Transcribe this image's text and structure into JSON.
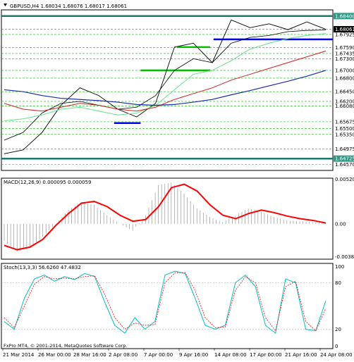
{
  "colors": {
    "background": "#ffffff",
    "panel_bg": "#000000",
    "grid": "#00c000",
    "price": "#000000",
    "ma_fast": "#000000",
    "ma_green": "#66e08a",
    "ma_red": "#d62020",
    "ma_blue": "#1a2bb0",
    "hline_teal": "#1a7a6e",
    "hline_blue": "#0000ff",
    "hline_green": "#00c000",
    "macd_hist": "#999999",
    "macd_signal": "#ff0000",
    "stoch_main": "#00c0c0",
    "stoch_signal": "#ff0000",
    "price_tag_bg": "#000000",
    "price_tag_text": "#ffffff",
    "level_tag_bg": "#2e9a86",
    "level_tag_text": "#ffffff"
  },
  "header": {
    "symbol_line": "GBPUSD,H4  1.68034  1.68076  1.68017  1.68061"
  },
  "chart_data": [
    {
      "type": "line",
      "panel": "price",
      "title": "GBPUSD,H4",
      "ohlc_header": {
        "open": 1.68034,
        "high": 1.68076,
        "low": 1.68017,
        "close": 1.68061
      },
      "ylim": [
        1.6442,
        1.6856
      ],
      "y_ticks": [
        "1.68400",
        "1.68061",
        "1.67925",
        "1.67590",
        "1.67435",
        "1.67300",
        "1.67000",
        "1.66800",
        "1.66450",
        "1.66200",
        "1.66080",
        "1.65675",
        "1.65500",
        "1.65350",
        "1.64975",
        "1.64725",
        "1.64570"
      ],
      "price_tag": "1.68061",
      "level_tags": [
        "1.68400",
        "1.64725"
      ],
      "horizontal_levels": [
        {
          "price": 1.684,
          "style": "thick",
          "color": "#1a7a6e"
        },
        {
          "price": 1.64725,
          "style": "thick",
          "color": "#1a7a6e"
        },
        {
          "price": 1.678,
          "style": "thick",
          "color": "#0000ff",
          "from": 0.64,
          "to": 1.0
        },
        {
          "price": 1.6564,
          "style": "thick",
          "color": "#0000ff",
          "from": 0.34,
          "to": 0.42
        },
        {
          "price": 1.67,
          "style": "thick",
          "color": "#00c000",
          "from": 0.42,
          "to": 0.63
        },
        {
          "price": 1.676,
          "style": "thick",
          "color": "#00c000",
          "from": 0.53,
          "to": 0.63
        }
      ],
      "x": [
        "21 Mar 2014",
        "26 Mar 00:00",
        "28 Mar 16:00",
        "2 Apr 08:00",
        "7 Apr 00:00",
        "9 Apr 16:00",
        "14 Apr 08:00",
        "17 Apr 00:00",
        "21 Apr 16:00",
        "24 Apr 08:00"
      ],
      "series": [
        {
          "name": "price",
          "values": [
            1.6485,
            1.6495,
            1.654,
            1.661,
            1.6655,
            1.6635,
            1.66,
            1.658,
            1.6615,
            1.676,
            1.677,
            1.672,
            1.683,
            1.681,
            1.682,
            1.6805,
            1.6825,
            1.6806
          ]
        },
        {
          "values": [
            1.652,
            1.654,
            1.659,
            1.6615,
            1.662,
            1.661,
            1.66,
            1.6605,
            1.6635,
            1.67,
            1.673,
            1.672,
            1.677,
            1.6785,
            1.679,
            1.68,
            1.6803,
            1.6804
          ]
        },
        {
          "values": [
            1.657,
            1.6575,
            1.6585,
            1.66,
            1.6605,
            1.6595,
            1.6585,
            1.659,
            1.661,
            1.665,
            1.669,
            1.67,
            1.6725,
            1.6755,
            1.677,
            1.6782,
            1.679,
            1.6795
          ]
        },
        {
          "values": [
            1.6615,
            1.66,
            1.6595,
            1.6605,
            1.6615,
            1.661,
            1.66,
            1.6595,
            1.6605,
            1.6625,
            1.664,
            1.6655,
            1.6675,
            1.669,
            1.6705,
            1.672,
            1.6735,
            1.675
          ]
        },
        {
          "values": [
            1.665,
            1.6645,
            1.6635,
            1.6628,
            1.6625,
            1.6622,
            1.6618,
            1.6612,
            1.661,
            1.6612,
            1.6618,
            1.6625,
            1.6637,
            1.6648,
            1.666,
            1.6672,
            1.6685,
            1.67
          ]
        }
      ]
    },
    {
      "type": "bar",
      "panel": "macd",
      "title": "MACD(12,26,9) 0.000095 0.000059",
      "ylim": [
        -0.0041,
        0.0053
      ],
      "y_ticks": [
        "0.005208",
        "0.00",
        "-0.003812"
      ],
      "series": [
        {
          "name": "histogram",
          "values": [
            -0.002,
            -0.0032,
            -0.0028,
            -0.0015,
            0.0,
            0.0016,
            0.0025,
            0.0022,
            0.001,
            0.0,
            -0.0008,
            0.001,
            0.0045,
            0.0048,
            0.0035,
            0.0018,
            0.0008,
            0.0002,
            0.001,
            0.0018,
            0.0014,
            0.0008,
            0.0004,
            0.0003,
            0.0002,
            0.0001
          ]
        },
        {
          "name": "signal",
          "values": [
            -0.0025,
            -0.003,
            -0.0027,
            -0.0018,
            -0.0002,
            0.0012,
            0.0024,
            0.0026,
            0.002,
            0.001,
            0.0003,
            0.0005,
            0.002,
            0.0042,
            0.0046,
            0.0038,
            0.0022,
            0.001,
            0.0006,
            0.0012,
            0.0016,
            0.0013,
            0.0009,
            0.0006,
            0.0004,
            0.0001
          ]
        }
      ]
    },
    {
      "type": "line",
      "panel": "stochastic",
      "title": "Stoch(13,3,3) 56.6260 47.4832",
      "ylim": [
        -5,
        105
      ],
      "y_ticks": [
        "100",
        "80",
        "20",
        "0"
      ],
      "series": [
        {
          "name": "main",
          "values": [
            30,
            20,
            60,
            85,
            90,
            82,
            88,
            84,
            92,
            88,
            55,
            25,
            15,
            35,
            20,
            30,
            90,
            95,
            92,
            60,
            25,
            20,
            25,
            80,
            90,
            75,
            25,
            15,
            85,
            80,
            20,
            18,
            57
          ]
        },
        {
          "name": "signal",
          "values": [
            35,
            22,
            50,
            78,
            88,
            85,
            86,
            85,
            88,
            89,
            65,
            35,
            20,
            28,
            25,
            26,
            80,
            93,
            93,
            70,
            35,
            22,
            23,
            70,
            88,
            80,
            35,
            18,
            75,
            82,
            30,
            18,
            47
          ]
        }
      ]
    }
  ],
  "footer": {
    "copyright": "FxPro MT4, © 2001-2014, MetaQuotes Software Corp."
  }
}
